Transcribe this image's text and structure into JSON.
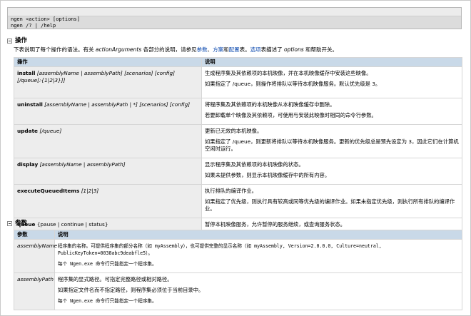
{
  "syntax": {
    "line1": "ngen <action> [options]",
    "line2": "ngen /? | /help"
  },
  "actions_section": {
    "title": "操作",
    "intro_prefix": "下表说明了每个操作的语法。有关",
    "intro_italic1": "actionArguments",
    "intro_mid": "各部分的说明，请参见",
    "link_params": "参数",
    "link_scenarios": "方案",
    "link_config": "配置",
    "intro_table": "表。",
    "link_options": "选项",
    "intro_mid2": "表描述了",
    "intro_italic2": "options",
    "intro_suffix": "和帮助开关。",
    "header_action": "操作",
    "header_desc": "说明",
    "rows": [
      {
        "syntax_bold": "install",
        "syntax_rest": "[assemblyName | assemblyPath] [scenarios] [config] [/queue[:{1|2|3}]]",
        "desc": [
          "生成程序集及其依赖项的本机映像，并在本机映像缓存中安装这些映像。",
          "如果指定了 /queue，则操作将排队以等待本机映像服务。默认优先级是 3。"
        ]
      },
      {
        "syntax_bold": "uninstall",
        "syntax_rest": "[assemblyName | assemblyPath | *] [scenarios] [config]",
        "desc": [
          "将程序集及其依赖项的本机映像从本机映像缓存中删除。",
          "若要卸载单个映像及其依赖项，可使用与安装此映像时相同的命令行参数。"
        ]
      },
      {
        "syntax_bold": "update",
        "syntax_rest": "[/queue]",
        "desc": [
          "更新已无效的本机映像。",
          "如果指定了 /queue，则更新将排队以等待本机映像服务。更新的优先级总是预先设定为 3，因此它们在计算机空闲时运行。"
        ]
      },
      {
        "syntax_bold": "display",
        "syntax_rest": "[assemblyName | assemblyPath]",
        "desc": [
          "显示程序集及其依赖项的本机映像的状态。",
          "如果未提供参数，则显示本机映像缓存中的所有内容。"
        ]
      },
      {
        "syntax_bold": "executeQueuedItems",
        "syntax_rest": "[1|2|3]",
        "desc": [
          "执行排队的编译作业。",
          "如果指定了优先级，则执行具有较高或同等优先级的编译作业。如果未指定优先级，则执行所有排队的编译作业。"
        ]
      },
      {
        "syntax_bold": "queue",
        "syntax_rest": "{pause | continue | status}",
        "desc": [
          "暂停本机映像服务，允许暂停的服务继续，或查询服务状态。"
        ]
      }
    ]
  },
  "params_section": {
    "title": "参数",
    "header_param": "参数",
    "header_desc": "说明",
    "rows": [
      {
        "name": "assemblyName",
        "desc": [
          "程序集的名称。可提供程序集的部分名称（如 myAssembly），也可提供完整的显示名称（如 myAssembly, Version=2.0.0.0, Culture=neutral, PublicKeyToken=0038abc9deabfle5）。",
          "每个 Ngen.exe 命令行只能指定一个程序集。"
        ]
      },
      {
        "name": "assemblyPath",
        "desc": [
          "程序集的显式路径。可指定完整路径或相对路径。",
          "如果指定文件名而不指定路径，则程序集必须位于当前目录中。",
          "每个 Ngen.exe 命令行只能指定一个程序集。"
        ]
      }
    ]
  }
}
